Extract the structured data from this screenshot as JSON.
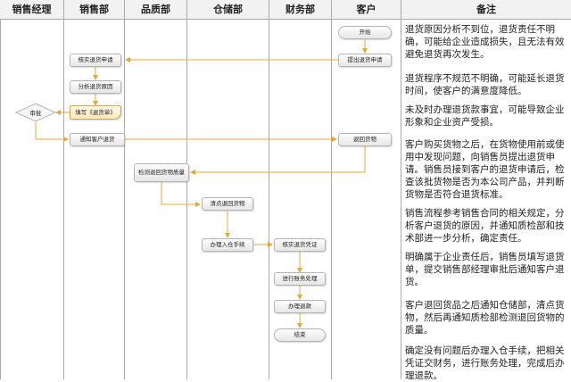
{
  "lanes": [
    "销售经理",
    "销售部",
    "品质部",
    "仓储部",
    "财务部",
    "客户",
    "备注"
  ],
  "nodes": {
    "start": "开始",
    "submit_return": "提出退货申请",
    "verify_return": "核实退货申请",
    "analyze_reason": "分析退货原因",
    "fill_form": "填写《退货单》",
    "approve": "审批",
    "notify_customer": "通知客户退货",
    "return_goods": "退回货物",
    "inspect_quality": "检测退回货物质量",
    "count_goods": "清点退回货物",
    "warehouse_entry": "办理入仓手续",
    "verify_voucher": "核实退货凭证",
    "account_process": "进行账务处理",
    "refund": "办理退款",
    "end": "结束"
  },
  "notes": [
    "退货原因分析不到位，退货责任不明确，可能给企业造成损失，且无法有效避免退货再次发生。",
    "退货程序不规范不明确，可能延长退货时间，使客户的满意度降低。",
    "未及时办理退货款事宜，可能导致企业形象和企业资产受损。",
    "客户购买货物之后，在货物使用前或使用中发现问题，向销售员提出退货申请。销售员接到客户的退货申请后，检查该批货物是否为本公司产品，并判断货物是否符合退货标准。",
    "销售流程参考销售合同的相关规定，分析客户退货的原因，并通知质检部和技术部进一步分析，确定责任。",
    "明确属于企业责任后，销售员填写退货单，提交销售部经理审批后通知客户退货。",
    "客户退回货品之后通知仓储部，清点货物，然后再通知质检部检测退回货物的质量。",
    "确定没有问题后办理入仓手续，把相关凭证交财务，进行账务处理，完成后办理退款。"
  ]
}
